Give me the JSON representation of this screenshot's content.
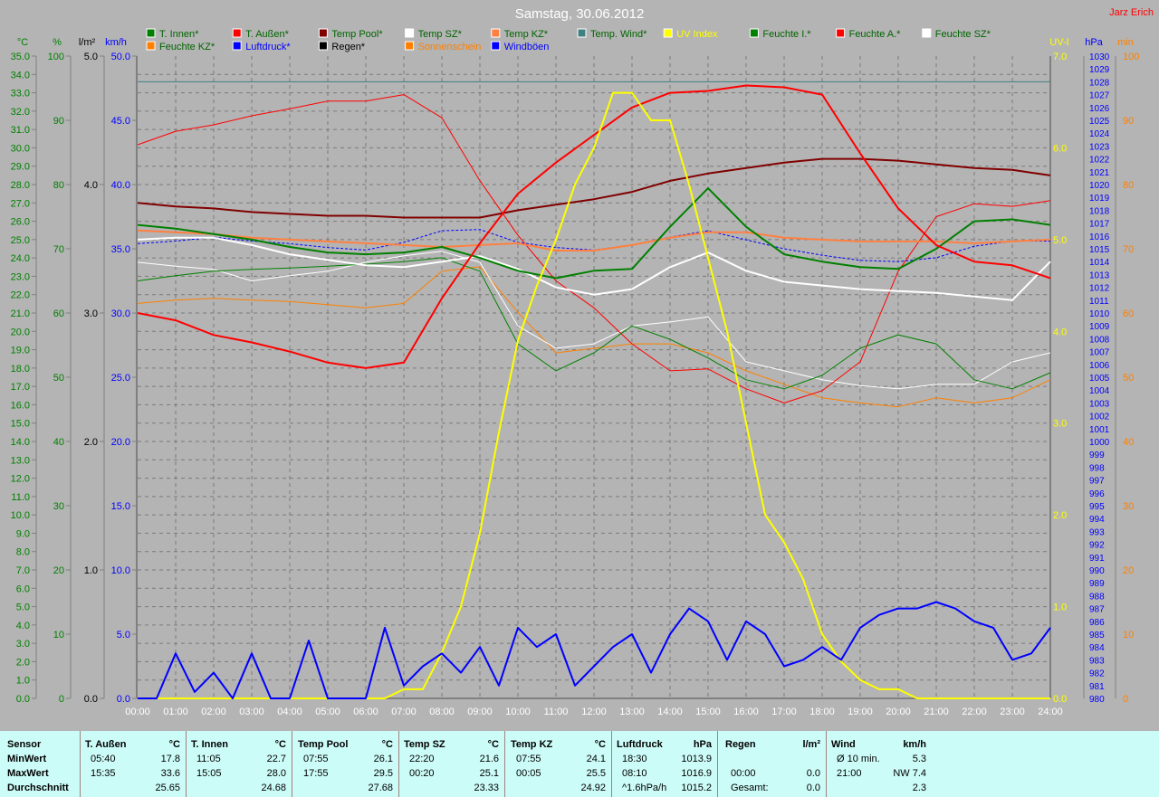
{
  "header": {
    "title": "Samstag, 30.06.2012",
    "author": "Jarz Erich"
  },
  "axis_titles": {
    "left": [
      "°C",
      "%",
      "l/m²",
      "km/h"
    ],
    "right": [
      "UV-I",
      "hPa",
      "min"
    ]
  },
  "legend": [
    {
      "label": "T. Innen*",
      "color": "#008000",
      "text": "#006400",
      "row": 0,
      "col": 0
    },
    {
      "label": "T. Außen*",
      "color": "#ff0000",
      "text": "#006400",
      "row": 0,
      "col": 1
    },
    {
      "label": "Temp Pool*",
      "color": "#800000",
      "text": "#006400",
      "row": 0,
      "col": 2
    },
    {
      "label": "Temp SZ*",
      "color": "#ffffff",
      "text": "#006400",
      "row": 0,
      "col": 3
    },
    {
      "label": "Temp KZ*",
      "color": "#ff8040",
      "text": "#006400",
      "row": 0,
      "col": 4
    },
    {
      "label": "Temp. Wind*",
      "color": "#408080",
      "text": "#006400",
      "row": 0,
      "col": 5
    },
    {
      "label": "UV Index",
      "color": "#ffff00",
      "text": "#ffff00",
      "row": 0,
      "col": 6
    },
    {
      "label": "Feuchte I.*",
      "color": "#008000",
      "text": "#006400",
      "row": 0,
      "col": 7
    },
    {
      "label": "Feuchte A.*",
      "color": "#ff0000",
      "text": "#006400",
      "row": 0,
      "col": 8
    },
    {
      "label": "Feuchte SZ*",
      "color": "#ffffff",
      "text": "#006400",
      "row": 0,
      "col": 9
    },
    {
      "label": "Feuchte KZ*",
      "color": "#ff8000",
      "text": "#006400",
      "row": 1,
      "col": 0
    },
    {
      "label": "Luftdruck*",
      "color": "#0000ff",
      "text": "#0000ff",
      "row": 1,
      "col": 1
    },
    {
      "label": "Regen*",
      "color": "#000000",
      "text": "#000000",
      "row": 1,
      "col": 2
    },
    {
      "label": "Sonnenschein",
      "color": "#ff8000",
      "text": "#ff8000",
      "row": 1,
      "col": 3
    },
    {
      "label": "Windböen",
      "color": "#0000ff",
      "text": "#0000ff",
      "row": 1,
      "col": 4
    }
  ],
  "chart_data": {
    "type": "line",
    "title": "Samstag, 30.06.2012",
    "x_ticks": [
      "00:00",
      "01:00",
      "02:00",
      "03:00",
      "04:00",
      "05:00",
      "06:00",
      "07:00",
      "08:00",
      "09:00",
      "10:00",
      "11:00",
      "12:00",
      "13:00",
      "14:00",
      "15:00",
      "16:00",
      "17:00",
      "18:00",
      "19:00",
      "20:00",
      "21:00",
      "22:00",
      "23:00",
      "24:00"
    ],
    "xlim": [
      0,
      24
    ],
    "grid": true,
    "axes": {
      "temp": {
        "range": [
          0,
          35
        ],
        "step": 1,
        "decimals": 1,
        "color": "#008000"
      },
      "hum": {
        "range": [
          0,
          100
        ],
        "step": 10,
        "decimals": 0,
        "color": "#008000"
      },
      "rain": {
        "range": [
          0,
          5
        ],
        "step": 1,
        "decimals": 1,
        "color": "#000000"
      },
      "wind": {
        "range": [
          0,
          50
        ],
        "step": 5,
        "decimals": 1,
        "color": "#0000ff"
      },
      "uv": {
        "range": [
          0,
          7
        ],
        "step": 1,
        "decimals": 1,
        "color": "#ffff00"
      },
      "press": {
        "range": [
          980,
          1030
        ],
        "step": 1,
        "decimals": 0,
        "color": "#0000ff"
      },
      "sun": {
        "range": [
          0,
          100
        ],
        "step": 10,
        "decimals": 0,
        "color": "#ff8000"
      }
    },
    "series": [
      {
        "name": "Temp. Wind",
        "axis": "temp",
        "color": "#408080",
        "width": 1,
        "values": [
          33.6,
          33.6,
          33.6,
          33.6,
          33.6,
          33.6,
          33.6,
          33.6,
          33.6,
          33.6,
          33.6,
          33.6,
          33.6,
          33.6,
          33.6,
          33.6,
          33.6,
          33.6,
          33.6,
          33.6,
          33.6,
          33.6,
          33.6,
          33.6,
          33.6
        ]
      },
      {
        "name": "Feuchte KZ",
        "axis": "hum",
        "color": "#ff8000",
        "width": 1,
        "values": [
          61.5,
          62.0,
          62.3,
          62.0,
          61.8,
          61.3,
          60.8,
          61.5,
          66.5,
          67.2,
          60.1,
          53.8,
          54.5,
          55.2,
          55.2,
          53.8,
          51.0,
          48.9,
          46.8,
          46.0,
          45.4,
          46.8,
          46.0,
          46.8,
          49.6
        ]
      },
      {
        "name": "Feuchte SZ",
        "axis": "hum",
        "color": "#ffffff",
        "width": 1,
        "values": [
          67.9,
          67.3,
          66.8,
          65.0,
          65.8,
          66.5,
          67.9,
          68.9,
          69.6,
          67.9,
          58.0,
          54.5,
          55.2,
          58.0,
          58.6,
          59.4,
          52.4,
          51.0,
          49.6,
          48.7,
          48.2,
          48.9,
          48.9,
          52.4,
          53.8
        ]
      },
      {
        "name": "Feuchte A.",
        "axis": "hum",
        "color": "#ff0000",
        "width": 1,
        "values": [
          86.2,
          88.3,
          89.3,
          90.7,
          91.8,
          93.0,
          93.0,
          94.0,
          90.4,
          80.6,
          72.1,
          65.0,
          60.8,
          55.2,
          51.0,
          51.3,
          48.2,
          46.0,
          47.9,
          52.4,
          66.5,
          75.0,
          77.0,
          76.6,
          77.5
        ]
      },
      {
        "name": "Feuchte I.",
        "axis": "hum",
        "color": "#008000",
        "width": 1,
        "values": [
          65.0,
          65.8,
          66.5,
          66.8,
          67.0,
          67.3,
          67.6,
          68.0,
          68.6,
          66.5,
          55.2,
          51.0,
          53.8,
          58.0,
          55.9,
          53.0,
          49.6,
          48.2,
          50.3,
          54.5,
          56.6,
          55.2,
          49.6,
          48.2,
          50.7
        ]
      },
      {
        "name": "Luftdruck",
        "axis": "press",
        "color": "#0000ff",
        "width": 1,
        "dash": "3,2",
        "values": [
          1015.4,
          1015.6,
          1015.9,
          1015.6,
          1015.4,
          1015.1,
          1014.9,
          1015.5,
          1016.4,
          1016.5,
          1015.5,
          1015.1,
          1014.9,
          1015.3,
          1015.9,
          1016.4,
          1015.7,
          1015.0,
          1014.5,
          1014.1,
          1014.0,
          1014.3,
          1015.2,
          1015.6,
          1015.6
        ]
      },
      {
        "name": "Temp KZ",
        "axis": "temp",
        "color": "#ff8040",
        "width": 2,
        "values": [
          25.5,
          25.4,
          25.3,
          25.1,
          25.0,
          24.9,
          24.8,
          24.7,
          24.6,
          24.7,
          24.8,
          24.4,
          24.4,
          24.7,
          25.1,
          25.4,
          25.4,
          25.1,
          25.0,
          24.9,
          24.9,
          24.9,
          24.8,
          24.9,
          25.0
        ]
      },
      {
        "name": "Temp SZ",
        "axis": "temp",
        "color": "#ffffff",
        "width": 2,
        "values": [
          25.0,
          25.1,
          25.1,
          24.7,
          24.2,
          23.9,
          23.6,
          23.5,
          23.8,
          24.1,
          23.4,
          22.4,
          22.0,
          22.3,
          23.5,
          24.3,
          23.3,
          22.7,
          22.5,
          22.3,
          22.2,
          22.1,
          21.9,
          21.7,
          23.8
        ]
      },
      {
        "name": "Temp Pool",
        "axis": "temp",
        "color": "#800000",
        "width": 2,
        "values": [
          27.0,
          26.8,
          26.7,
          26.5,
          26.4,
          26.3,
          26.3,
          26.2,
          26.2,
          26.2,
          26.6,
          26.9,
          27.2,
          27.6,
          28.2,
          28.6,
          28.9,
          29.2,
          29.4,
          29.4,
          29.3,
          29.1,
          28.9,
          28.8,
          28.5
        ]
      },
      {
        "name": "T. Innen",
        "axis": "temp",
        "color": "#008000",
        "width": 2,
        "values": [
          25.8,
          25.6,
          25.3,
          25.0,
          24.6,
          24.3,
          24.2,
          24.3,
          24.6,
          24.0,
          23.3,
          22.9,
          23.3,
          23.4,
          25.7,
          27.8,
          25.7,
          24.2,
          23.8,
          23.5,
          23.4,
          24.5,
          26.0,
          26.1,
          25.8
        ]
      },
      {
        "name": "T. Außen",
        "axis": "temp",
        "color": "#ff0000",
        "width": 2,
        "values": [
          21.0,
          20.6,
          19.8,
          19.4,
          18.9,
          18.3,
          18.0,
          18.3,
          21.8,
          24.8,
          27.5,
          29.2,
          30.7,
          32.2,
          33.0,
          33.1,
          33.4,
          33.3,
          32.9,
          29.7,
          26.7,
          24.7,
          23.8,
          23.6,
          22.9
        ]
      },
      {
        "name": "UV Index",
        "axis": "uv",
        "color": "#ffff00",
        "width": 2,
        "step_hours": 0.5,
        "values": [
          0,
          0,
          0,
          0,
          0,
          0,
          0,
          0,
          0,
          0,
          0,
          0,
          0,
          0,
          0.1,
          0.1,
          0.5,
          1.0,
          1.8,
          2.9,
          3.9,
          4.5,
          5.0,
          5.6,
          6.0,
          6.6,
          6.6,
          6.3,
          6.3,
          5.6,
          4.8,
          4.0,
          3.0,
          2.0,
          1.7,
          1.3,
          0.7,
          0.4,
          0.2,
          0.1,
          0.1,
          0,
          0,
          0,
          0,
          0,
          0,
          0,
          0
        ]
      },
      {
        "name": "Windböen",
        "axis": "wind",
        "color": "#0000ff",
        "width": 2,
        "step_hours": 0.5,
        "values": [
          0,
          0,
          3.5,
          0.5,
          2.0,
          0,
          3.5,
          0,
          0,
          4.5,
          0,
          0,
          0,
          5.5,
          1.0,
          2.5,
          3.5,
          2.0,
          4.0,
          1.0,
          5.5,
          4.0,
          5.0,
          1.0,
          2.5,
          4.0,
          5.0,
          2.0,
          5.0,
          7.0,
          6.0,
          3.0,
          6.0,
          5.0,
          2.5,
          3.0,
          4.0,
          3.0,
          5.5,
          6.5,
          7.0,
          7.0,
          7.5,
          7.0,
          6.0,
          5.5,
          3.0,
          3.5,
          5.5
        ]
      }
    ]
  },
  "stats": {
    "row_labels": [
      "Sensor",
      "MinWert",
      "MaxWert",
      "Durchschnitt"
    ],
    "columns": [
      {
        "name": "T. Außen",
        "unit": "°C",
        "rows": [
          [
            "05:40",
            "17.8"
          ],
          [
            "15:35",
            "33.6"
          ],
          [
            "",
            "25.65"
          ]
        ]
      },
      {
        "name": "T. Innen",
        "unit": "°C",
        "rows": [
          [
            "11:05",
            "22.7"
          ],
          [
            "15:05",
            "28.0"
          ],
          [
            "",
            "24.68"
          ]
        ]
      },
      {
        "name": "Temp Pool",
        "unit": "°C",
        "rows": [
          [
            "07:55",
            "26.1"
          ],
          [
            "17:55",
            "29.5"
          ],
          [
            "",
            "27.68"
          ]
        ]
      },
      {
        "name": "Temp SZ",
        "unit": "°C",
        "rows": [
          [
            "22:20",
            "21.6"
          ],
          [
            "00:20",
            "25.1"
          ],
          [
            "",
            "23.33"
          ]
        ]
      },
      {
        "name": "Temp KZ",
        "unit": "°C",
        "rows": [
          [
            "07:55",
            "24.1"
          ],
          [
            "00:05",
            "25.5"
          ],
          [
            "",
            "24.92"
          ]
        ]
      },
      {
        "name": "Luftdruck",
        "unit": "hPa",
        "rows": [
          [
            "18:30",
            "1013.9"
          ],
          [
            "08:10",
            "1016.9"
          ],
          [
            "^1.6hPa/h",
            "1015.2"
          ]
        ]
      },
      {
        "name": "Regen",
        "unit": "l/m²",
        "rows": [
          [
            "",
            ""
          ],
          [
            "00:00",
            "0.0"
          ],
          [
            "Gesamt:",
            "0.0"
          ]
        ]
      },
      {
        "name": "Wind",
        "unit": "km/h",
        "rows": [
          [
            "Ø 10 min.",
            "5.3"
          ],
          [
            "21:00",
            "NW 7.4"
          ],
          [
            "",
            "2.3"
          ]
        ]
      }
    ]
  }
}
